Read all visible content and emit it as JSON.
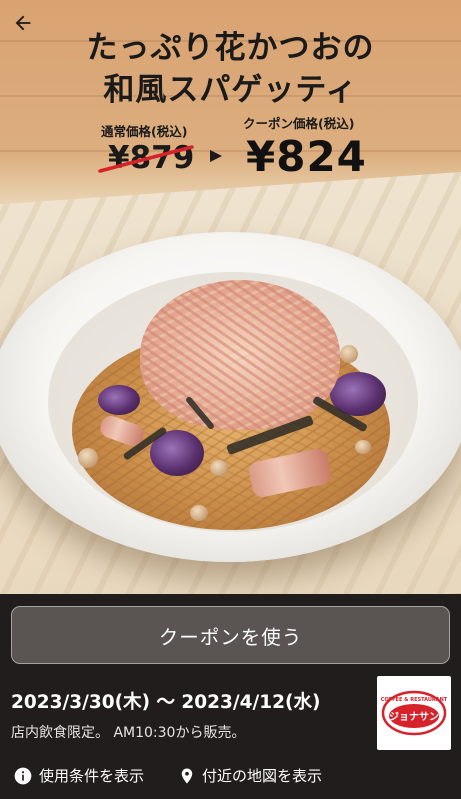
{
  "header": {
    "title_line1": "たっぷり花かつおの",
    "title_line2": "和風スパゲッティ"
  },
  "prices": {
    "regular_label": "通常価格(税込)",
    "regular_price": "¥879",
    "coupon_label": "クーポン価格(税込)",
    "coupon_price": "¥824"
  },
  "actions": {
    "use_coupon_label": "クーポンを使う",
    "terms_label": "使用条件を表示",
    "map_label": "付近の地図を表示"
  },
  "validity": {
    "date_range": "2023/3/30(木) 〜 2023/4/12(水)",
    "note": "店内飲食限定。 AM10:30から販売。"
  },
  "brand": {
    "logo_small_text": "COFFEE & RESTAURANT",
    "logo_main_text": "ジョナサン",
    "logo_color": "#d6232b"
  },
  "colors": {
    "panel_bg": "#201d1c",
    "button_bg": "#5a5553",
    "strike_red": "#d6232b"
  },
  "icons": {
    "back": "arrow-left-icon",
    "price_arrow": "triangle-right-icon",
    "terms": "info-icon",
    "map": "location-pin-icon"
  }
}
